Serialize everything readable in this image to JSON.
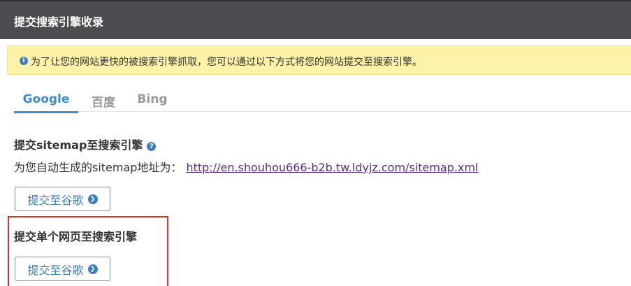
{
  "header": {
    "title": "提交搜索引擎收录"
  },
  "notice": {
    "icon": "info-icon",
    "text": "为了让您的网站更快的被搜索引擎抓取，您可以通过以下方式将您的网站提交至搜索引擎。"
  },
  "tabs": [
    {
      "label": "Google",
      "active": true
    },
    {
      "label": "百度",
      "active": false
    },
    {
      "label": "Bing",
      "active": false
    }
  ],
  "sitemap_section": {
    "title": "提交sitemap至搜索引擎",
    "help_icon": "question-circle-icon",
    "address_label": "为您自动生成的sitemap地址为：",
    "url": "http://en.shouhou666-b2b.tw.ldyjz.com/sitemap.xml",
    "button_label": "提交至谷歌"
  },
  "single_page_section": {
    "title": "提交单个网页至搜索引擎",
    "button_label": "提交至谷歌"
  },
  "colors": {
    "header_bg": "#4a4c4f",
    "notice_bg": "#fcf2a8",
    "accent": "#3c8dcc",
    "highlight": "#d9342b"
  }
}
